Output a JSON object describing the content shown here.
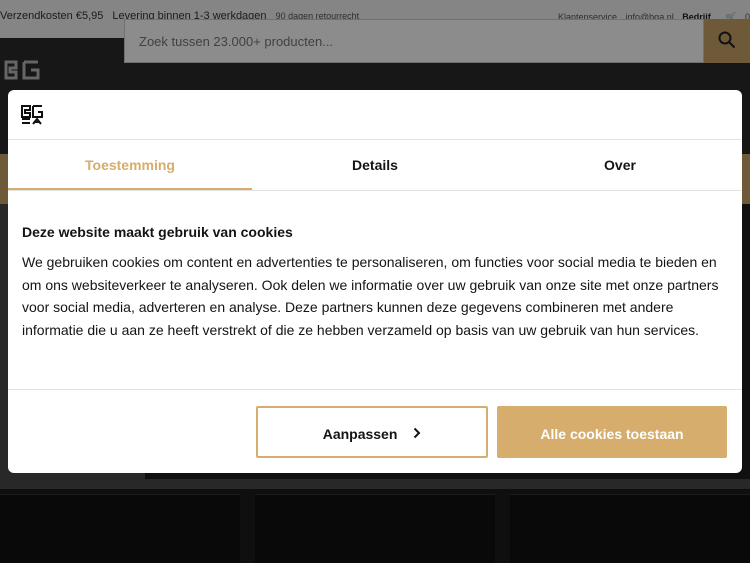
{
  "topbar": {
    "shipping": "Verzendkosten €5,95",
    "delivery": "Levering binnen 1-3 werkdagen",
    "returns": "90 dagen retourrecht",
    "customer_service": "Klantenservice",
    "email": "info@bga.nl",
    "business": "Bedrijf",
    "cart_count": "0"
  },
  "header": {
    "search_placeholder": "Zoek tussen 23.000+ producten..."
  },
  "cookie_dialog": {
    "tabs": [
      "Toestemming",
      "Details",
      "Over"
    ],
    "active_tab": "Toestemming",
    "title": "Deze website maakt gebruik van cookies",
    "body": "We gebruiken cookies om content en advertenties te personaliseren, om functies voor social media te bieden en om ons websiteverkeer te analyseren. Ook delen we informatie over uw gebruik van onze site met onze partners voor social media, adverteren en analyse. Deze partners kunnen deze gegevens combineren met andere informatie die u aan ze heeft verstrekt of die ze hebben verzameld op basis van uw gebruik van hun services.",
    "customize_label": "Aanpassen",
    "allow_all_label": "Alle cookies toestaan"
  },
  "colors": {
    "accent": "#d6ad6c",
    "header_bg": "#2a2a2a"
  }
}
